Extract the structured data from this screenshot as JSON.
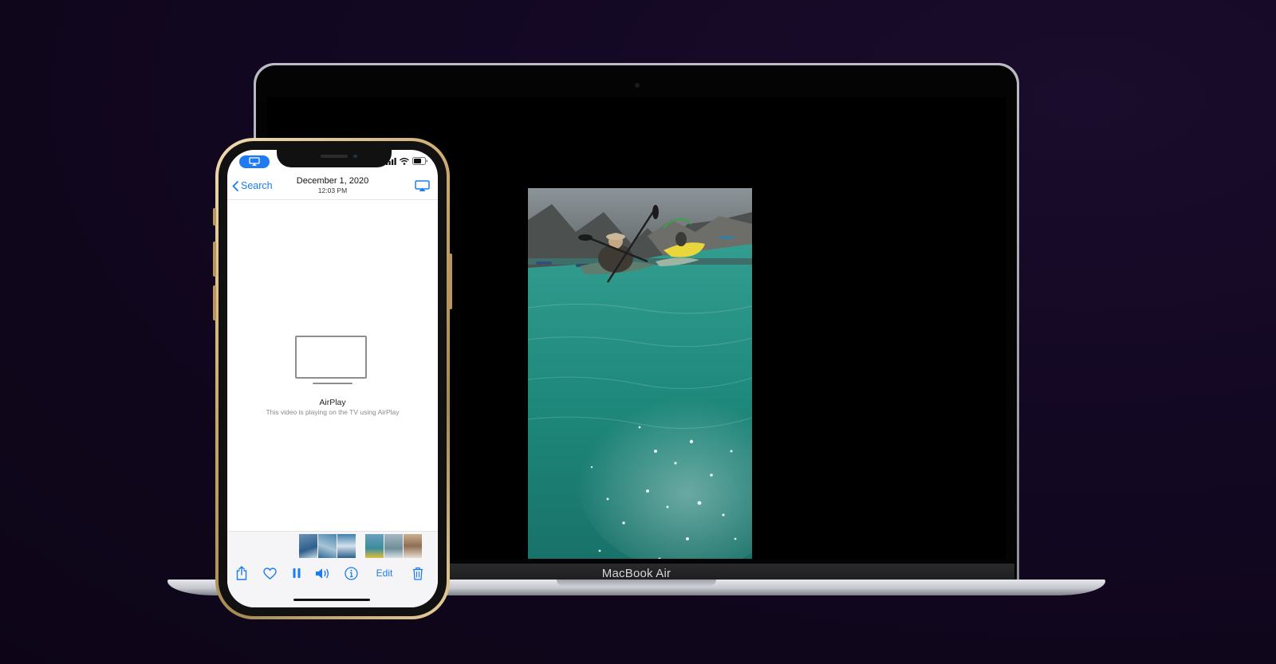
{
  "laptop": {
    "model_label": "MacBook Air",
    "close_icon": "close-icon"
  },
  "phone": {
    "nav": {
      "back_label": "Search",
      "date": "December 1, 2020",
      "time": "12:03 PM"
    },
    "airplay": {
      "title": "AirPlay",
      "subtitle": "This video is playing on the TV using AirPlay"
    },
    "toolbar": {
      "edit_label": "Edit",
      "icons": [
        "share-icon",
        "heart-icon",
        "pause-icon",
        "speaker-icon",
        "info-icon",
        "trash-icon"
      ]
    },
    "accent_color": "#1a7cf5",
    "airplay_pill_color": "#1e7bf2"
  }
}
